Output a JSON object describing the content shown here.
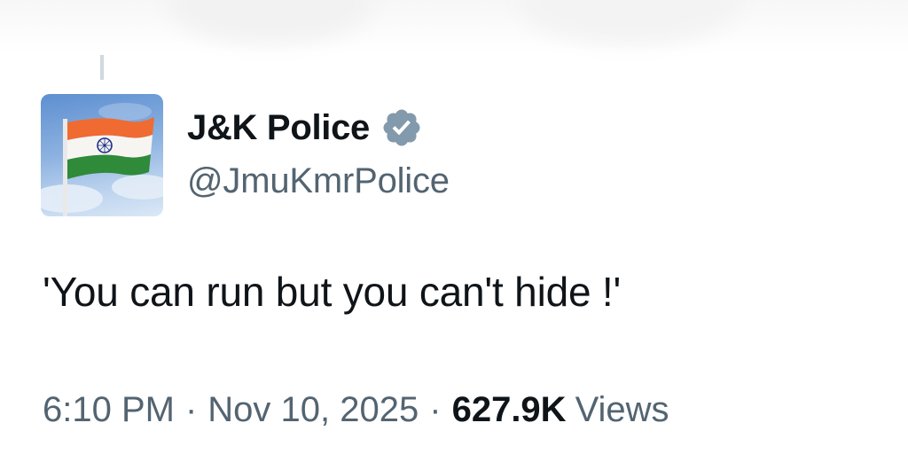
{
  "account": {
    "display_name": "J&K Police",
    "handle": "@JmuKmrPolice",
    "verified_badge_icon": "verified-badge-icon",
    "verified_badge_color": "#829aab",
    "avatar_icon": "indian-flag-avatar"
  },
  "tweet": {
    "text": "'You can run but you can't hide !'",
    "time": "6:10 PM",
    "separator": "·",
    "date": "Nov 10, 2025",
    "views_count": "627.9K",
    "views_label": "Views"
  },
  "colors": {
    "text_primary": "#0f1419",
    "text_secondary": "#536471",
    "thread_line": "#cfd9de"
  }
}
